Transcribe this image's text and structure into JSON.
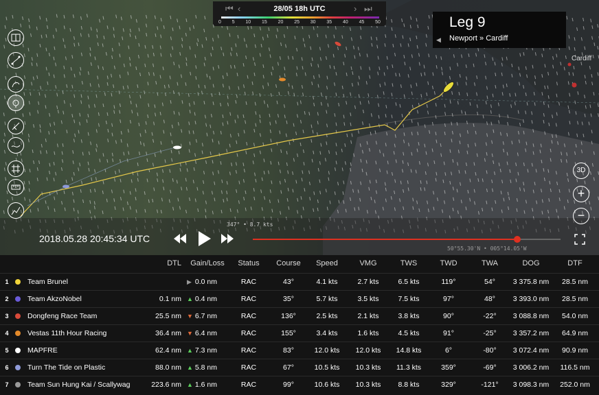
{
  "timebar": {
    "date": "28/05 18h UTC",
    "scale_ticks": [
      "0",
      "5",
      "10",
      "15",
      "20",
      "25",
      "30",
      "35",
      "40",
      "45",
      "50"
    ]
  },
  "leg": {
    "title": "Leg 9",
    "route": "Newport » Cardiff"
  },
  "map": {
    "city": "Cardiff",
    "wind_readout": "347° • 8.7 kts",
    "cursor_position": "50°55.30'N • 005°14.05'W"
  },
  "playback": {
    "clock": "2018.05.28 20:45:34 UTC",
    "progress": 0.86
  },
  "right_controls": {
    "view3d": "3D"
  },
  "table": {
    "headers": [
      "DTL",
      "Gain/Loss",
      "Status",
      "Course",
      "Speed",
      "VMG",
      "TWS",
      "TWD",
      "TWA",
      "DOG",
      "DTF"
    ],
    "rows": [
      {
        "rank": "1",
        "name": "Team Brunel",
        "color": "#f1d43a",
        "dtl": "",
        "trend": "flat",
        "gain": "0.0 nm",
        "status": "RAC",
        "course": "43°",
        "speed": "4.1 kts",
        "vmg": "2.7 kts",
        "tws": "6.5 kts",
        "twd": "119°",
        "twa": "54°",
        "dog": "3 375.8 nm",
        "dtf": "28.5 nm"
      },
      {
        "rank": "2",
        "name": "Team AkzoNobel",
        "color": "#6a5bd8",
        "dtl": "0.1 nm",
        "trend": "up",
        "gain": "0.4 nm",
        "status": "RAC",
        "course": "35°",
        "speed": "5.7 kts",
        "vmg": "3.5 kts",
        "tws": "7.5 kts",
        "twd": "97°",
        "twa": "48°",
        "dog": "3 393.0 nm",
        "dtf": "28.5 nm"
      },
      {
        "rank": "3",
        "name": "Dongfeng Race Team",
        "color": "#d84a3a",
        "dtl": "25.5 nm",
        "trend": "down",
        "gain": "6.7 nm",
        "status": "RAC",
        "course": "136°",
        "speed": "2.5 kts",
        "vmg": "2.1 kts",
        "tws": "3.8 kts",
        "twd": "90°",
        "twa": "-22°",
        "dog": "3 088.8 nm",
        "dtf": "54.0 nm"
      },
      {
        "rank": "4",
        "name": "Vestas 11th Hour Racing",
        "color": "#e48a2a",
        "dtl": "36.4 nm",
        "trend": "down",
        "gain": "6.4 nm",
        "status": "RAC",
        "course": "155°",
        "speed": "3.4 kts",
        "vmg": "1.6 kts",
        "tws": "4.5 kts",
        "twd": "91°",
        "twa": "-25°",
        "dog": "3 357.2 nm",
        "dtf": "64.9 nm"
      },
      {
        "rank": "5",
        "name": "MAPFRE",
        "color": "#ffffff",
        "dtl": "62.4 nm",
        "trend": "up",
        "gain": "7.3 nm",
        "status": "RAC",
        "course": "83°",
        "speed": "12.0 kts",
        "vmg": "12.0 kts",
        "tws": "14.8 kts",
        "twd": "6°",
        "twa": "-80°",
        "dog": "3 072.4 nm",
        "dtf": "90.9 nm"
      },
      {
        "rank": "6",
        "name": "Turn The Tide on Plastic",
        "color": "#8f9ad8",
        "dtl": "88.0 nm",
        "trend": "up",
        "gain": "5.8 nm",
        "status": "RAC",
        "course": "67°",
        "speed": "10.5 kts",
        "vmg": "10.3 kts",
        "tws": "11.3 kts",
        "twd": "359°",
        "twa": "-69°",
        "dog": "3 006.2 nm",
        "dtf": "116.5 nm"
      },
      {
        "rank": "7",
        "name": "Team Sun Hung Kai / Scallywag",
        "color": "#9a9a9a",
        "dtl": "223.6 nm",
        "trend": "up",
        "gain": "1.6 nm",
        "status": "RAC",
        "course": "99°",
        "speed": "10.6 kts",
        "vmg": "10.3 kts",
        "tws": "8.8 kts",
        "twd": "329°",
        "twa": "-121°",
        "dog": "3 098.3 nm",
        "dtf": "252.0 nm"
      }
    ]
  }
}
